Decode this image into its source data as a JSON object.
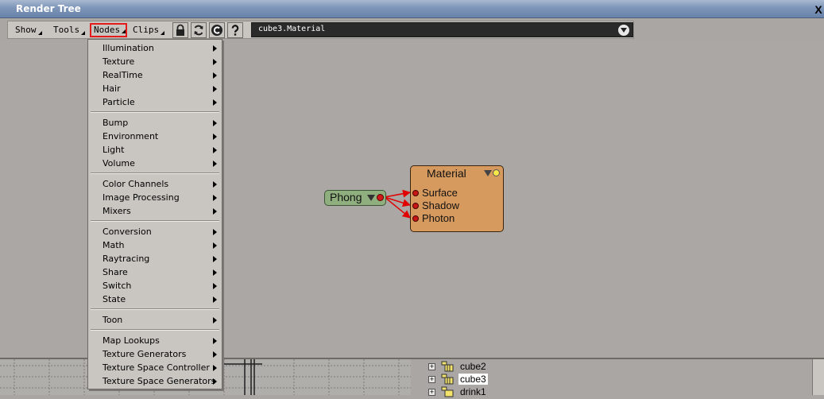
{
  "window": {
    "title": "Render Tree",
    "close_label": "X"
  },
  "toolbar": {
    "menus": [
      "Show",
      "Tools",
      "Nodes",
      "Clips"
    ],
    "icons": [
      "lock-icon",
      "refresh-icon",
      "clear-icon",
      "help-icon"
    ],
    "path": "cube3.Material"
  },
  "popup_menu": {
    "groups": [
      [
        "Illumination",
        "Texture",
        "RealTime",
        "Hair",
        "Particle"
      ],
      [
        "Bump",
        "Environment",
        "Light",
        "Volume"
      ],
      [
        "Color Channels",
        "Image Processing",
        "Mixers"
      ],
      [
        "Conversion",
        "Math",
        "Raytracing",
        "Share",
        "Switch",
        "State"
      ],
      [
        "Toon"
      ],
      [
        "Map Lookups",
        "Texture Generators",
        "Texture Space Controller",
        "Texture Space Generators"
      ]
    ]
  },
  "nodes": {
    "phong": {
      "label": "Phong"
    },
    "material": {
      "label": "Material",
      "ports": [
        "Surface",
        "Shadow",
        "Photon"
      ]
    }
  },
  "explorer": {
    "items": [
      "cube2",
      "cube3",
      "drink1"
    ],
    "selected": "cube3"
  },
  "colors": {
    "accent_highlight": "#e31b1b",
    "phong_node": "#8faf7e",
    "material_node": "#d69a5e",
    "port_red": "#d01818",
    "link_red": "#e00000"
  }
}
